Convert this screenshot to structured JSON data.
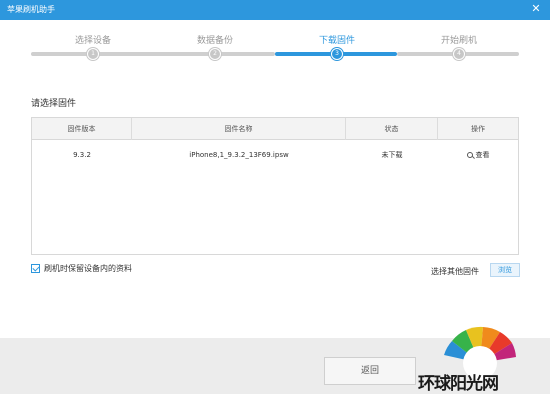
{
  "window": {
    "title": "苹果刷机助手"
  },
  "steps": [
    {
      "label": "选择设备",
      "num": "1",
      "active": false
    },
    {
      "label": "数据备份",
      "num": "2",
      "active": false
    },
    {
      "label": "下载固件",
      "num": "3",
      "active": true
    },
    {
      "label": "开始刷机",
      "num": "4",
      "active": false
    }
  ],
  "section": {
    "title": "请选择固件"
  },
  "table": {
    "columns": [
      "固件版本",
      "固件名称",
      "状态",
      "操作"
    ],
    "rows": [
      {
        "version": "9.3.2",
        "name": "iPhone8,1_9.3.2_13F69.ipsw",
        "status": "未下载",
        "action": "查看"
      }
    ]
  },
  "options": {
    "keep_data_label": "刷机时保留设备内的资料",
    "keep_data_checked": true,
    "other_firmware_label": "选择其他固件",
    "browse_label": "浏览"
  },
  "footer": {
    "back_label": "返回"
  },
  "watermark": {
    "text": "环球阳光网"
  },
  "colors": {
    "accent": "#2d97dd"
  }
}
